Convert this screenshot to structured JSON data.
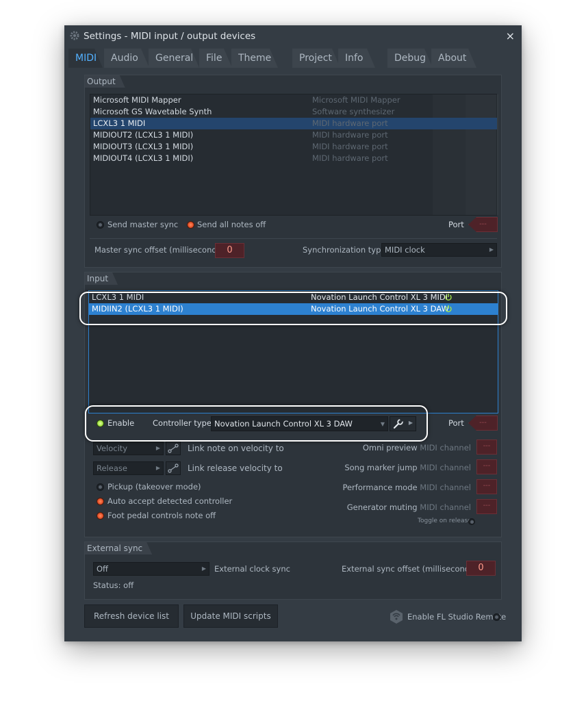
{
  "window": {
    "title": "Settings - MIDI input / output devices",
    "close_label": "×"
  },
  "tabs": [
    {
      "label": "MIDI"
    },
    {
      "label": "Audio"
    },
    {
      "label": "General"
    },
    {
      "label": "File"
    },
    {
      "label": "Theme"
    },
    {
      "label": "Project"
    },
    {
      "label": "Info"
    },
    {
      "label": "Debug"
    },
    {
      "label": "About"
    }
  ],
  "output": {
    "section_label": "Output",
    "devices": [
      {
        "name": "Microsoft MIDI Mapper",
        "desc": "Microsoft MIDI Mapper"
      },
      {
        "name": "Microsoft GS Wavetable Synth",
        "desc": "Software synthesizer"
      },
      {
        "name": "LCXL3 1 MIDI",
        "desc": "MIDI hardware port"
      },
      {
        "name": "MIDIOUT2 (LCXL3 1 MIDI)",
        "desc": "MIDI hardware port"
      },
      {
        "name": "MIDIOUT3 (LCXL3 1 MIDI)",
        "desc": "MIDI hardware port"
      },
      {
        "name": "MIDIOUT4 (LCXL3 1 MIDI)",
        "desc": "MIDI hardware port"
      }
    ],
    "send_master_sync": "Send master sync",
    "send_all_notes_off": "Send all notes off",
    "port_label": "Port",
    "port_value": "---",
    "master_sync_offset_label": "Master sync offset (milliseconds)",
    "master_sync_offset_value": "0",
    "sync_type_label": "Synchronization type",
    "sync_type_value": "MIDI clock"
  },
  "input": {
    "section_label": "Input",
    "devices": [
      {
        "name": "LCXL3 1 MIDI",
        "desc": "Novation Launch Control XL 3 MIDI"
      },
      {
        "name": "MIDIIN2 (LCXL3 1 MIDI)",
        "desc": "Novation Launch Control XL 3 DAW"
      }
    ],
    "enable_label": "Enable",
    "controller_type_label": "Controller type",
    "controller_type_value": "Novation Launch Control XL 3 DAW",
    "port_label": "Port",
    "port_value": "---",
    "velocity_combo": "Velocity",
    "link_velocity_label": "Link note on velocity to",
    "release_combo": "Release",
    "link_release_label": "Link release velocity to",
    "pickup_label": "Pickup (takeover mode)",
    "auto_accept_label": "Auto accept detected controller",
    "foot_pedal_label": "Foot pedal controls note off",
    "omni_preview_label": "Omni preview",
    "song_marker_label": "Song marker jump",
    "performance_mode_label": "Performance mode",
    "generator_muting_label": "Generator muting",
    "midi_channel_label": "MIDI channel",
    "channel_value": "---",
    "toggle_on_release_label": "Toggle on release"
  },
  "external_sync": {
    "section_label": "External sync",
    "clock_value": "Off",
    "clock_label": "External clock sync",
    "offset_label": "External sync offset (milliseconds)",
    "offset_value": "0",
    "status": "Status: off"
  },
  "footer": {
    "refresh_label": "Refresh device list",
    "update_scripts_label": "Update MIDI scripts",
    "remote_label": "Enable FL Studio Remote"
  },
  "colors": {
    "accent_blue": "#2d81d0",
    "tab_active": "#53b1ff",
    "power_green": "#a6e64a"
  }
}
